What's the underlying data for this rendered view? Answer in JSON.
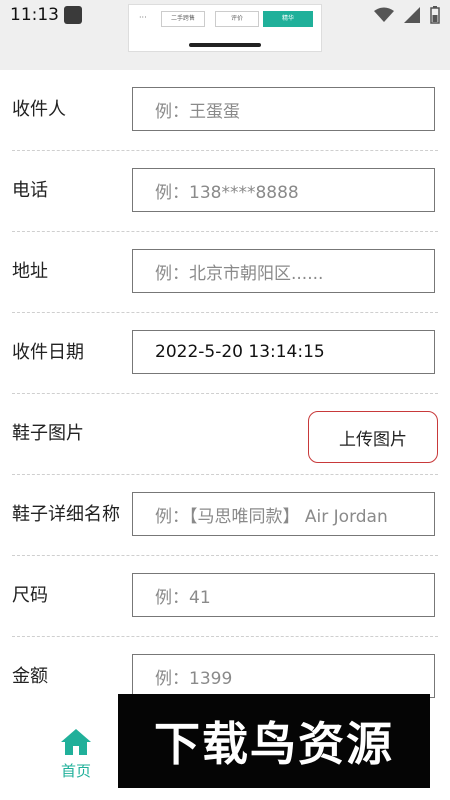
{
  "status_bar": {
    "time": "11:13"
  },
  "preview": {
    "dots": "···",
    "tabs": [
      "二手跨售",
      "评价",
      "精华"
    ]
  },
  "form": {
    "recipient": {
      "label": "收件人",
      "placeholder": "例：王蛋蛋"
    },
    "phone": {
      "label": "电话",
      "placeholder": "例：138****8888"
    },
    "address": {
      "label": "地址",
      "placeholder": "例：北京市朝阳区......"
    },
    "date": {
      "label": "收件日期",
      "value": "2022-5-20 13:14:15"
    },
    "shoe_image": {
      "label": "鞋子图片",
      "button": "上传图片"
    },
    "shoe_name": {
      "label": "鞋子详细名称",
      "placeholder": "例：【马思唯同款】 Air Jordan"
    },
    "size": {
      "label": "尺码",
      "placeholder": "例：41"
    },
    "amount": {
      "label": "金额",
      "placeholder": "例：1399"
    }
  },
  "bottom_nav": {
    "home": "首页"
  },
  "watermark": "下载鸟资源",
  "colors": {
    "accent": "#20b09a",
    "upload_border": "#c8393a"
  },
  "icons": [
    "wifi-icon",
    "signal-icon",
    "battery-icon",
    "home-icon"
  ]
}
